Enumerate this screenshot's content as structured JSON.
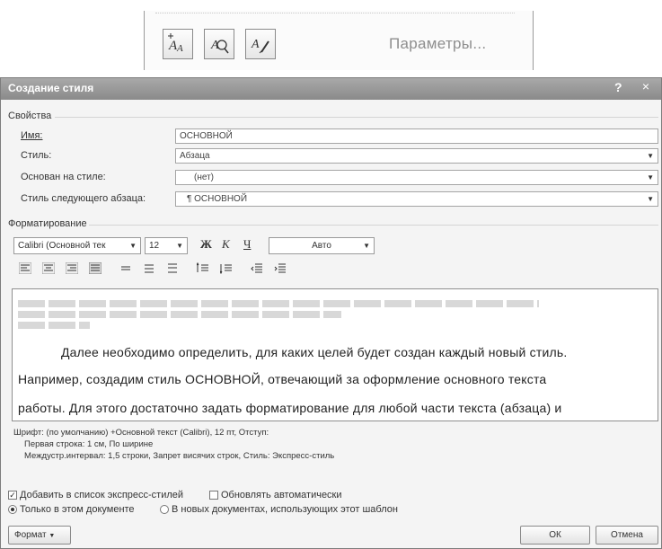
{
  "top_panel": {
    "buttons": [
      {
        "icon": "new-style-icon"
      },
      {
        "icon": "style-inspector-icon"
      },
      {
        "icon": "manage-styles-icon"
      }
    ],
    "params_label": "Параметры..."
  },
  "dialog": {
    "title": "Создание стиля",
    "help": "?",
    "close": "×",
    "properties": {
      "header": "Свойства",
      "name_label": "Имя:",
      "name_value": "ОСНОВНОЙ",
      "type_label": "Стиль:",
      "type_value": "Абзаца",
      "based_label": "Основан на стиле:",
      "based_value": "(нет)",
      "next_label": "Стиль следующего абзаца:",
      "next_value": "¶ ОСНОВНОЙ"
    },
    "formatting": {
      "header": "Форматирование",
      "font": "Calibri (Основной тек",
      "size": "12",
      "bold": "Ж",
      "italic": "К",
      "underline": "Ч",
      "color": "Авто"
    },
    "preview": {
      "line1": "Далее необходимо определить, для каких целей будет создан каждый новый стиль.",
      "line2": "Например, создадим стиль ОСНОВНОЙ, отвечающий за оформление основного текста",
      "line3": "работы. Для этого достаточно задать форматирование для любой части текста (абзаца) и"
    },
    "description": {
      "line1": "Шрифт: (по умолчанию) +Основной текст (Calibri), 12 пт, Отступ:",
      "line2": "Первая строка: 1 см, По ширине",
      "line3": "Междустр.интервал: 1,5 строки, Запрет висячих строк, Стиль: Экспресс-стиль"
    },
    "options": {
      "add_quick": "Добавить в список экспресс-стилей",
      "add_quick_checked": true,
      "auto_update": "Обновлять автоматически",
      "auto_update_checked": false,
      "only_doc": "Только в этом документе",
      "new_docs": "В новых документах, использующих этот шаблон"
    },
    "buttons": {
      "format": "Формат",
      "ok": "ОК",
      "cancel": "Отмена"
    }
  }
}
